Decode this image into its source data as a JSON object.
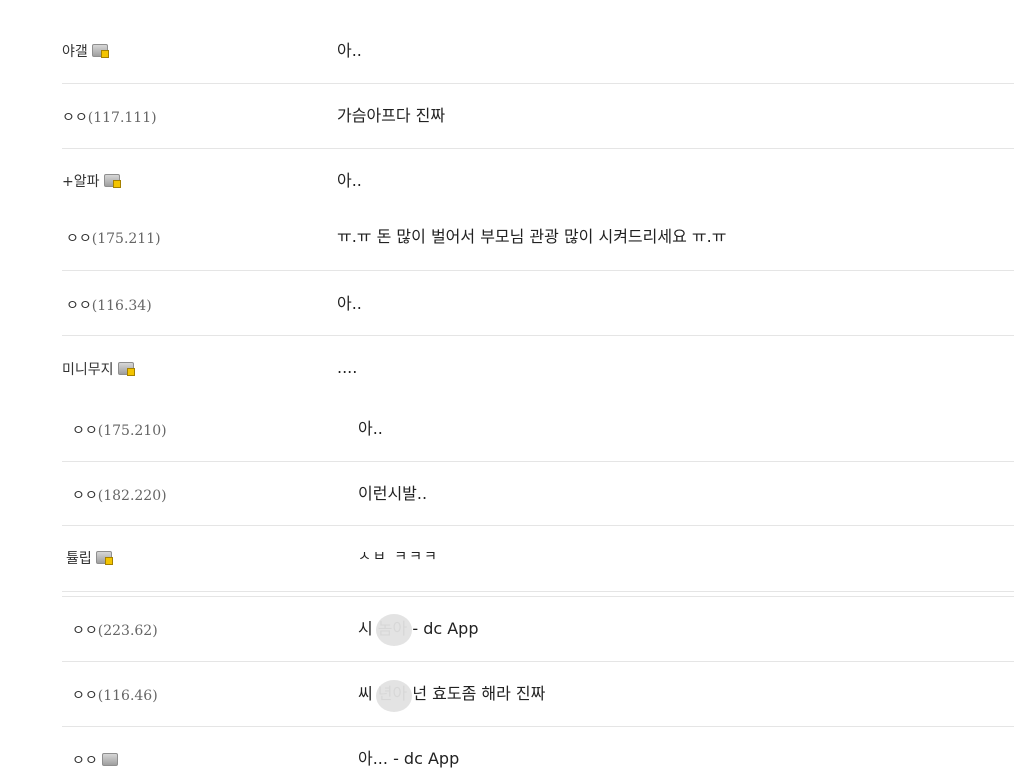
{
  "comments": [
    {
      "nick": "야갤",
      "ip": "",
      "icon": "gallog-icon",
      "message": "아.."
    },
    {
      "nick": "ㅇㅇ",
      "ip": "(117.111)",
      "icon": "",
      "message": "가슴아프다 진짜"
    },
    {
      "nick": "+알파",
      "ip": "",
      "icon": "gallog-icon",
      "message": "아.."
    },
    {
      "nick": "ㅇㅇ",
      "ip": "(175.211)",
      "icon": "",
      "message": "ㅠ.ㅠ 돈 많이 벌어서 부모님 관광 많이 시켜드리세요 ㅠ.ㅠ"
    },
    {
      "nick": "ㅇㅇ",
      "ip": "(116.34)",
      "icon": "",
      "message": "아.."
    },
    {
      "nick": "미니무지",
      "ip": "",
      "icon": "gallog-icon",
      "message": "...."
    },
    {
      "nick": "ㅇㅇ",
      "ip": "(175.210)",
      "icon": "",
      "message": "아.."
    },
    {
      "nick": "ㅇㅇ",
      "ip": "(182.220)",
      "icon": "",
      "message": "이런시발.."
    },
    {
      "nick": "튤립",
      "ip": "",
      "icon": "gallog-icon",
      "message": "ㅅㅂ ㅋㅋㅋ"
    },
    {
      "nick": "ㅇㅇ",
      "ip": "(223.62)",
      "icon": "",
      "message": "시  놈아 - dc App"
    },
    {
      "nick": "ㅇㅇ",
      "ip": "(116.46)",
      "icon": "",
      "message": "씨  년아 넌 효도좀 해라 진짜"
    },
    {
      "nick": "ㅇㅇ",
      "ip": "",
      "icon": "gallog-icon-plain",
      "message": "아... - dc App"
    }
  ]
}
